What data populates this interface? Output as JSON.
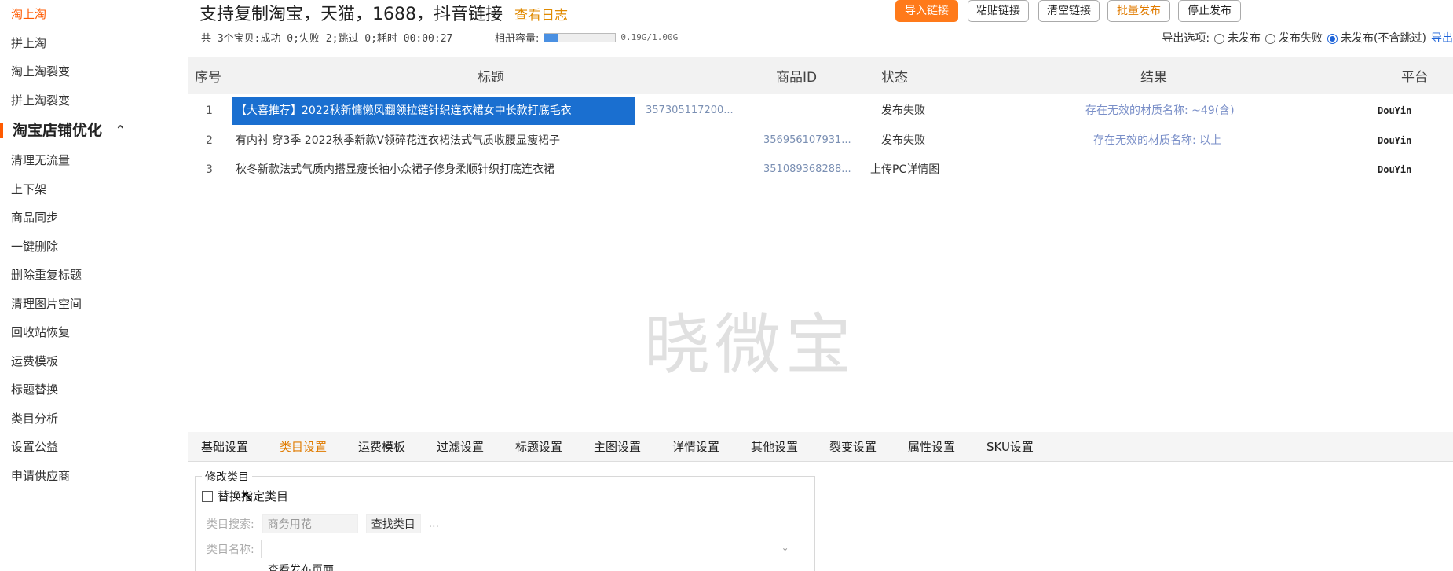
{
  "sidebar": {
    "top_items": [
      {
        "label": "淘上淘",
        "active": true
      },
      {
        "label": "拼上淘",
        "active": false
      },
      {
        "label": "淘上淘裂变",
        "active": false
      },
      {
        "label": "拼上淘裂变",
        "active": false
      }
    ],
    "section": {
      "label": "淘宝店铺优化",
      "chevron": "chevron-up-icon"
    },
    "items": [
      "清理无流量",
      "上下架",
      "商品同步",
      "一键删除",
      "删除重复标题",
      "清理图片空间",
      "回收站恢复",
      "运费模板",
      "标题替换",
      "类目分析",
      "设置公益",
      "申请供应商"
    ]
  },
  "header": {
    "title": "支持复制淘宝，天猫，1688，抖音链接",
    "log_link": "查看日志",
    "stats": "共 3个宝贝:成功 0;失败 2;跳过 0;耗时 00:00:27",
    "capacity_label": "相册容量:",
    "capacity_value": "0.19G/1.00G",
    "capacity_fraction": 0.19,
    "buttons": {
      "import": "导入链接",
      "paste": "粘贴链接",
      "clear": "清空链接",
      "batch": "批量发布",
      "stop": "停止发布"
    },
    "export": {
      "label": "导出选项:",
      "options": [
        "未发布",
        "发布失败",
        "未发布(不含跳过)"
      ],
      "selected_index": 2,
      "action": "导出"
    }
  },
  "table": {
    "columns": [
      "序号",
      "标题",
      "商品ID",
      "状态",
      "结果",
      "平台"
    ],
    "rows": [
      {
        "num": "1",
        "title": "【大喜推荐】2022秋新慵懒风翻领拉链针织连衣裙女中长款打底毛衣",
        "id": "357305117200...",
        "status": "发布失败",
        "result": "存在无效的材质名称: ~49(含)",
        "platform": "DouYin",
        "selected": true
      },
      {
        "num": "2",
        "title": "有内衬 穿3季 2022秋季新款V领碎花连衣裙法式气质收腰显瘦裙子",
        "id": "356956107931...",
        "status": "发布失败",
        "result": "存在无效的材质名称: 以上",
        "platform": "DouYin",
        "selected": false
      },
      {
        "num": "3",
        "title": "秋冬新款法式气质内搭显瘦长袖小众裙子修身柔顺针织打底连衣裙",
        "id": "351089368288...",
        "status": "上传PC详情图",
        "result": "",
        "platform": "DouYin",
        "selected": false
      }
    ],
    "watermark": "晓微宝"
  },
  "settings": {
    "tabs": [
      "基础设置",
      "类目设置",
      "运费模板",
      "过滤设置",
      "标题设置",
      "主图设置",
      "详情设置",
      "其他设置",
      "裂变设置",
      "属性设置",
      "SKU设置"
    ],
    "active_tab": 1,
    "panel_title": "修改类目",
    "replace_label": "替换指定类目",
    "search_label": "类目搜索:",
    "search_value": "商务用花",
    "find_button": "查找类目",
    "dots": "...",
    "name_label": "类目名称:",
    "preview_text": "查看发布页面"
  }
}
